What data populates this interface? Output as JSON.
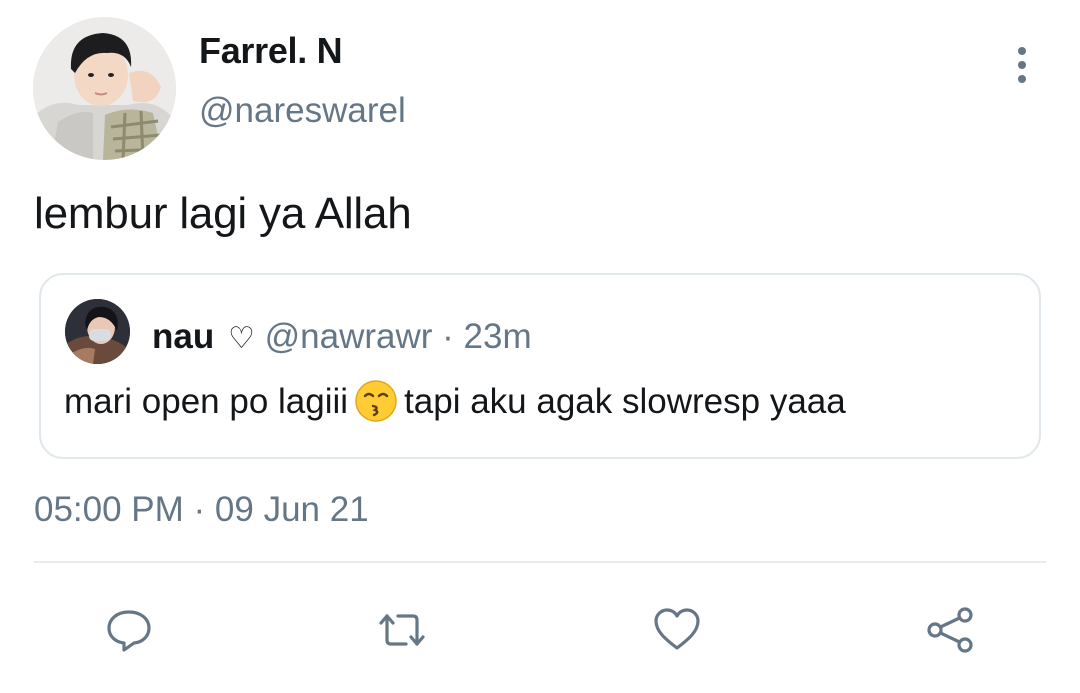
{
  "tweet": {
    "author": {
      "display_name": "Farrel. N",
      "handle": "@nareswarel"
    },
    "text": "lembur lagi ya Allah",
    "timestamp": "05:00 PM · 09 Jun 21",
    "quoted": {
      "display_name": "nau",
      "heart": "♡",
      "handle": "@nawrawr",
      "separator": "·",
      "time": "23m",
      "text_before_emoji": "mari open po lagiii",
      "emoji": "kissing-face-emoji",
      "text_after_emoji": "tapi aku agak slowresp yaaa"
    }
  },
  "actions": [
    "reply-icon",
    "retweet-icon",
    "like-icon",
    "share-icon"
  ],
  "colors": {
    "text": "#14171a",
    "secondary": "#657786",
    "border": "#e1e8ed"
  }
}
